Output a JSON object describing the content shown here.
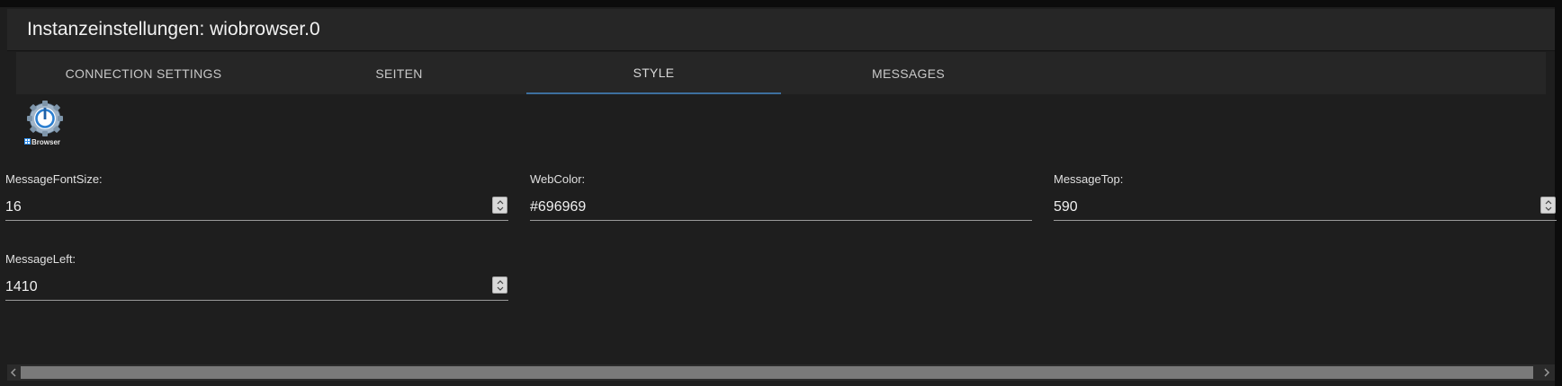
{
  "header": {
    "title": "Instanzeinstellungen: wiobrowser.0"
  },
  "tabs": [
    {
      "label": "CONNECTION SETTINGS",
      "active": false
    },
    {
      "label": "SEITEN",
      "active": false
    },
    {
      "label": "STYLE",
      "active": true
    },
    {
      "label": "MESSAGES",
      "active": false
    }
  ],
  "logo": {
    "icon": "gear-power-icon",
    "caption": "Browser"
  },
  "fields": {
    "message_font_size": {
      "label": "MessageFontSize:",
      "value": "16",
      "type": "number"
    },
    "web_color": {
      "label": "WebColor:",
      "value": "#696969",
      "type": "text"
    },
    "message_top": {
      "label": "MessageTop:",
      "value": "590",
      "type": "number"
    },
    "message_left": {
      "label": "MessageLeft:",
      "value": "1410",
      "type": "number"
    }
  },
  "colors": {
    "background": "#1e1e1e",
    "header": "#262626",
    "active_tab_underline": "#3d6f9e",
    "text": "#e6e6e6"
  }
}
